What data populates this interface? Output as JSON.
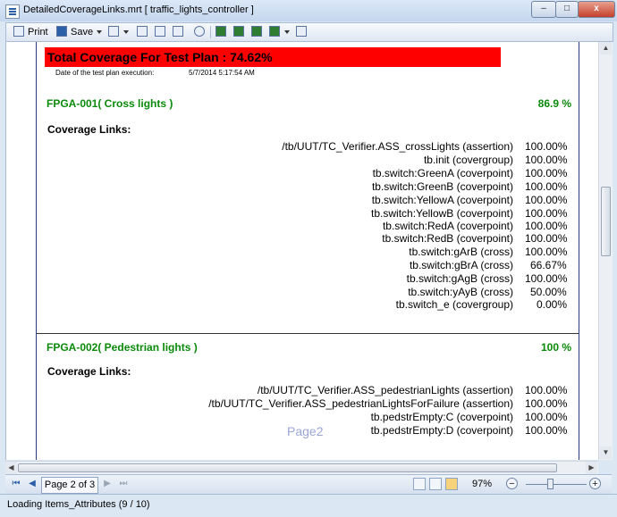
{
  "window": {
    "title": "DetailedCoverageLinks.mrt  [ traffic_lights_controller ]",
    "minimize_label": "–",
    "maximize_label": "□",
    "close_label": "x"
  },
  "toolbar": {
    "print_label": "Print",
    "save_label": "Save",
    "icons": [
      "print-icon",
      "save-icon",
      "export-icon",
      "page-setup-icon",
      "help-icon",
      "table-of-contents-icon",
      "find-icon",
      "single-page-icon",
      "two-page-icon",
      "multi-page-icon",
      "full-screen-icon",
      "send-email-icon"
    ]
  },
  "report": {
    "total_coverage": "Total Coverage For Test Plan : 74.62%",
    "date_label": "Date of the test plan execution:",
    "date_value": "5/7/2014 5:17:54 AM",
    "sections": [
      {
        "title": "FPGA-001( Cross lights )",
        "percent": "86.9 %",
        "links_header": "Coverage Links:",
        "links": [
          {
            "name": "/tb/UUT/TC_Verifier.ASS_crossLights (assertion)",
            "value": "100.00%"
          },
          {
            "name": "tb.init (covergroup)",
            "value": "100.00%"
          },
          {
            "name": "tb.switch:GreenA (coverpoint)",
            "value": "100.00%"
          },
          {
            "name": "tb.switch:GreenB (coverpoint)",
            "value": "100.00%"
          },
          {
            "name": "tb.switch:YellowA (coverpoint)",
            "value": "100.00%"
          },
          {
            "name": "tb.switch:YellowB (coverpoint)",
            "value": "100.00%"
          },
          {
            "name": "tb.switch:RedA (coverpoint)",
            "value": "100.00%"
          },
          {
            "name": "tb.switch:RedB (coverpoint)",
            "value": "100.00%"
          },
          {
            "name": "tb.switch:gArB (cross)",
            "value": "100.00%"
          },
          {
            "name": "tb.switch:gBrA (cross)",
            "value": "66.67%"
          },
          {
            "name": "tb.switch:gAgB (cross)",
            "value": "100.00%"
          },
          {
            "name": "tb.switch:yAyB (cross)",
            "value": "50.00%"
          },
          {
            "name": "tb.switch_e (covergroup)",
            "value": "0.00%"
          }
        ]
      },
      {
        "title": "FPGA-002( Pedestrian lights )",
        "percent": "100 %",
        "links_header": "Coverage Links:",
        "links": [
          {
            "name": "/tb/UUT/TC_Verifier.ASS_pedestrianLights (assertion)",
            "value": "100.00%"
          },
          {
            "name": "/tb/UUT/TC_Verifier.ASS_pedestrianLightsForFailure (assertion)",
            "value": "100.00%"
          },
          {
            "name": "tb.pedstrEmpty:C (coverpoint)",
            "value": "100.00%"
          },
          {
            "name": "tb.pedstrEmpty:D (coverpoint)",
            "value": "100.00%"
          }
        ]
      }
    ],
    "watermark": "Page2"
  },
  "navigation": {
    "page_indicator": "Page 2 of 3",
    "zoom": "97%",
    "zoom_minus": "−",
    "zoom_plus": "+"
  },
  "status": {
    "text": "Loading Items_Attributes (9 / 10)"
  },
  "colors": {
    "banner": "#ff0000",
    "section_title": "#0a8a0a",
    "page_border": "#2a3a7a"
  }
}
